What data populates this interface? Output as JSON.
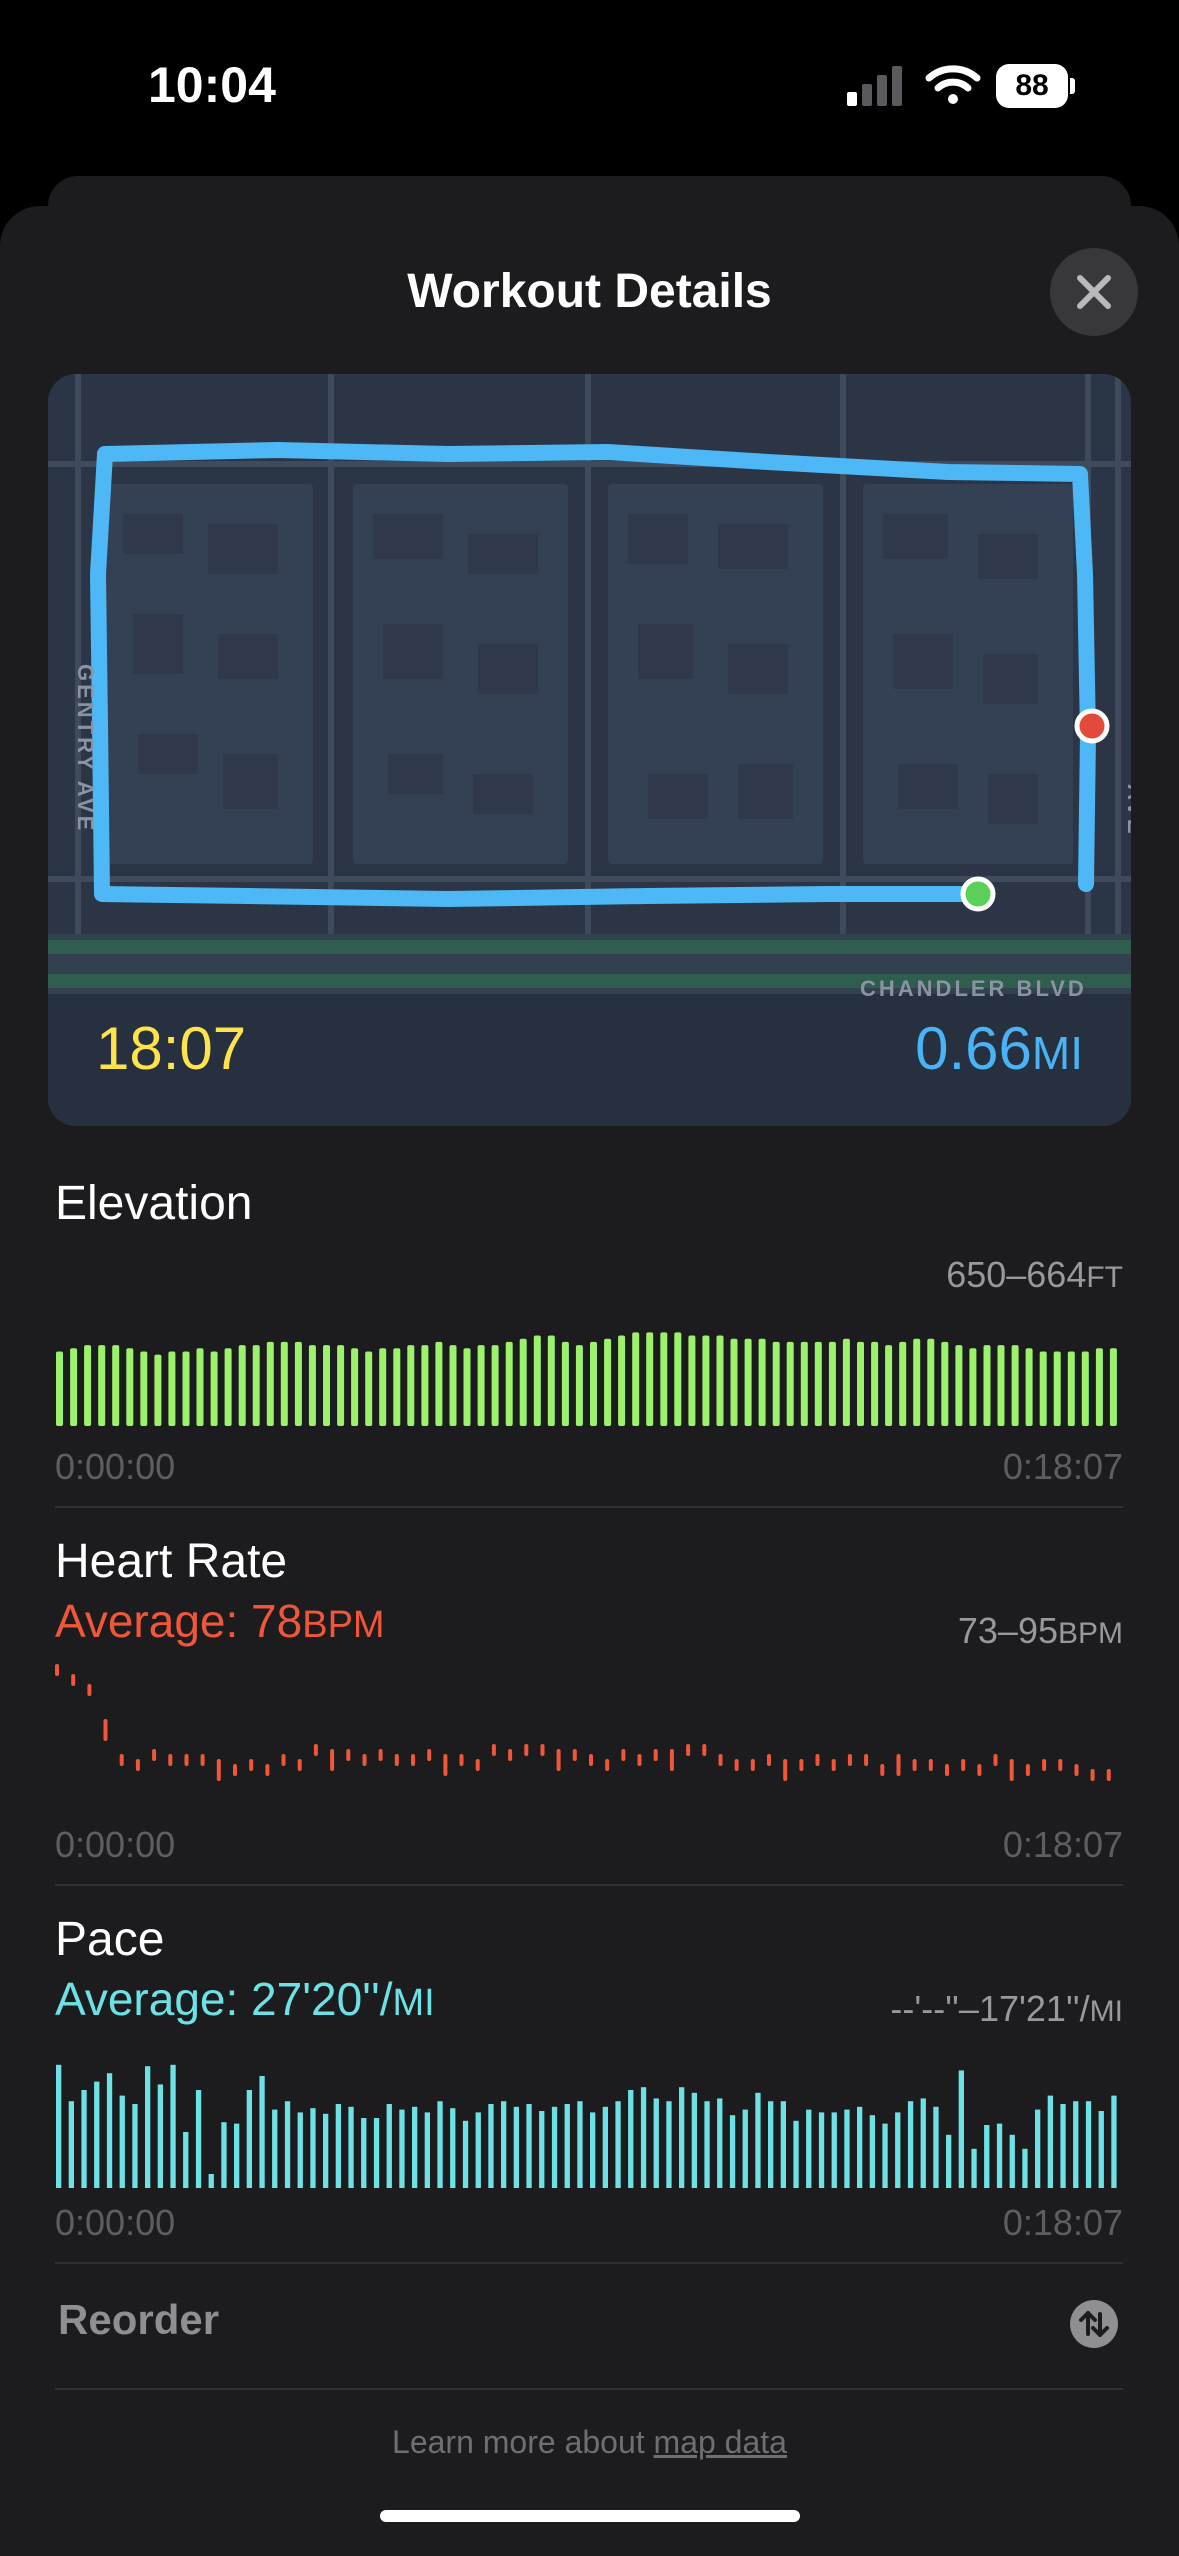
{
  "status_bar": {
    "time": "10:04",
    "battery": "88"
  },
  "sheet": {
    "title": "Workout Details"
  },
  "map": {
    "duration": "18:07",
    "distance_value": "0.66",
    "distance_unit": "MI",
    "streets": [
      "GENTRY AVE",
      "AVE",
      "CHANDLER BLVD"
    ],
    "route_color": "#4db8f5",
    "start_color": "#5ad05a",
    "end_color": "#e24a3b"
  },
  "elevation": {
    "title": "Elevation",
    "range_value": "650–664",
    "range_unit": "FT",
    "axis_start": "0:00:00",
    "axis_end": "0:18:07",
    "color": "#9cf26b"
  },
  "heart_rate": {
    "title": "Heart Rate",
    "avg_prefix": "Average: 78",
    "avg_unit": "BPM",
    "range_value": "73–95",
    "range_unit": "BPM",
    "axis_start": "0:00:00",
    "axis_end": "0:18:07",
    "color": "#f0573a"
  },
  "pace": {
    "title": "Pace",
    "avg_prefix": "Average: 27'20''/",
    "avg_unit": "MI",
    "range_value": "--'--''–17'21''/",
    "range_unit": "MI",
    "axis_start": "0:00:00",
    "axis_end": "0:18:07",
    "color": "#6ce2e6"
  },
  "reorder": {
    "label": "Reorder"
  },
  "footnote": {
    "prefix": "Learn more about ",
    "link": "map data"
  },
  "chart_data": [
    {
      "type": "bar",
      "title": "Elevation",
      "ylim": [
        650,
        664
      ],
      "x_range": [
        "0:00:00",
        "0:18:07"
      ],
      "values": [
        654,
        655,
        656,
        656,
        656,
        655,
        654,
        653,
        654,
        654,
        655,
        654,
        655,
        656,
        656,
        657,
        657,
        657,
        656,
        656,
        656,
        655,
        654,
        655,
        655,
        656,
        656,
        657,
        656,
        655,
        656,
        656,
        657,
        658,
        659,
        659,
        657,
        656,
        657,
        658,
        659,
        660,
        660,
        660,
        660,
        659,
        659,
        659,
        658,
        658,
        658,
        657,
        657,
        657,
        657,
        657,
        658,
        657,
        657,
        656,
        657,
        658,
        658,
        657,
        656,
        655,
        656,
        656,
        656,
        655,
        654,
        654,
        654,
        654,
        655,
        655
      ]
    },
    {
      "type": "line",
      "title": "Heart Rate",
      "ylim": [
        73,
        95
      ],
      "x_range": [
        "0:00:00",
        "0:18:07"
      ],
      "values": [
        95,
        93,
        91,
        84,
        77,
        76,
        78,
        77,
        77,
        77,
        76,
        75,
        76,
        75,
        77,
        76,
        79,
        78,
        78,
        77,
        78,
        77,
        77,
        78,
        77,
        77,
        76,
        79,
        78,
        79,
        79,
        78,
        78,
        77,
        76,
        78,
        77,
        78,
        78,
        79,
        79,
        77,
        76,
        76,
        77,
        76,
        76,
        77,
        76,
        77,
        77,
        75,
        77,
        76,
        76,
        75,
        76,
        75,
        77,
        76,
        75,
        76,
        76,
        75,
        74,
        74
      ]
    },
    {
      "type": "bar",
      "title": "Pace",
      "x_range": [
        "0:00:00",
        "0:18:07"
      ],
      "values": [
        88,
        62,
        70,
        76,
        82,
        66,
        60,
        87,
        74,
        88,
        40,
        70,
        10,
        47,
        46,
        70,
        80,
        56,
        62,
        54,
        57,
        53,
        60,
        58,
        50,
        50,
        60,
        56,
        58,
        54,
        62,
        57,
        48,
        54,
        60,
        62,
        58,
        60,
        55,
        58,
        60,
        62,
        54,
        58,
        62,
        70,
        72,
        64,
        62,
        72,
        68,
        62,
        64,
        52,
        56,
        68,
        62,
        62,
        48,
        56,
        54,
        54,
        56,
        58,
        52,
        46,
        54,
        62,
        64,
        58,
        38,
        84,
        28,
        45,
        46,
        38,
        28,
        56,
        66,
        60,
        62,
        62,
        55,
        66
      ]
    }
  ]
}
